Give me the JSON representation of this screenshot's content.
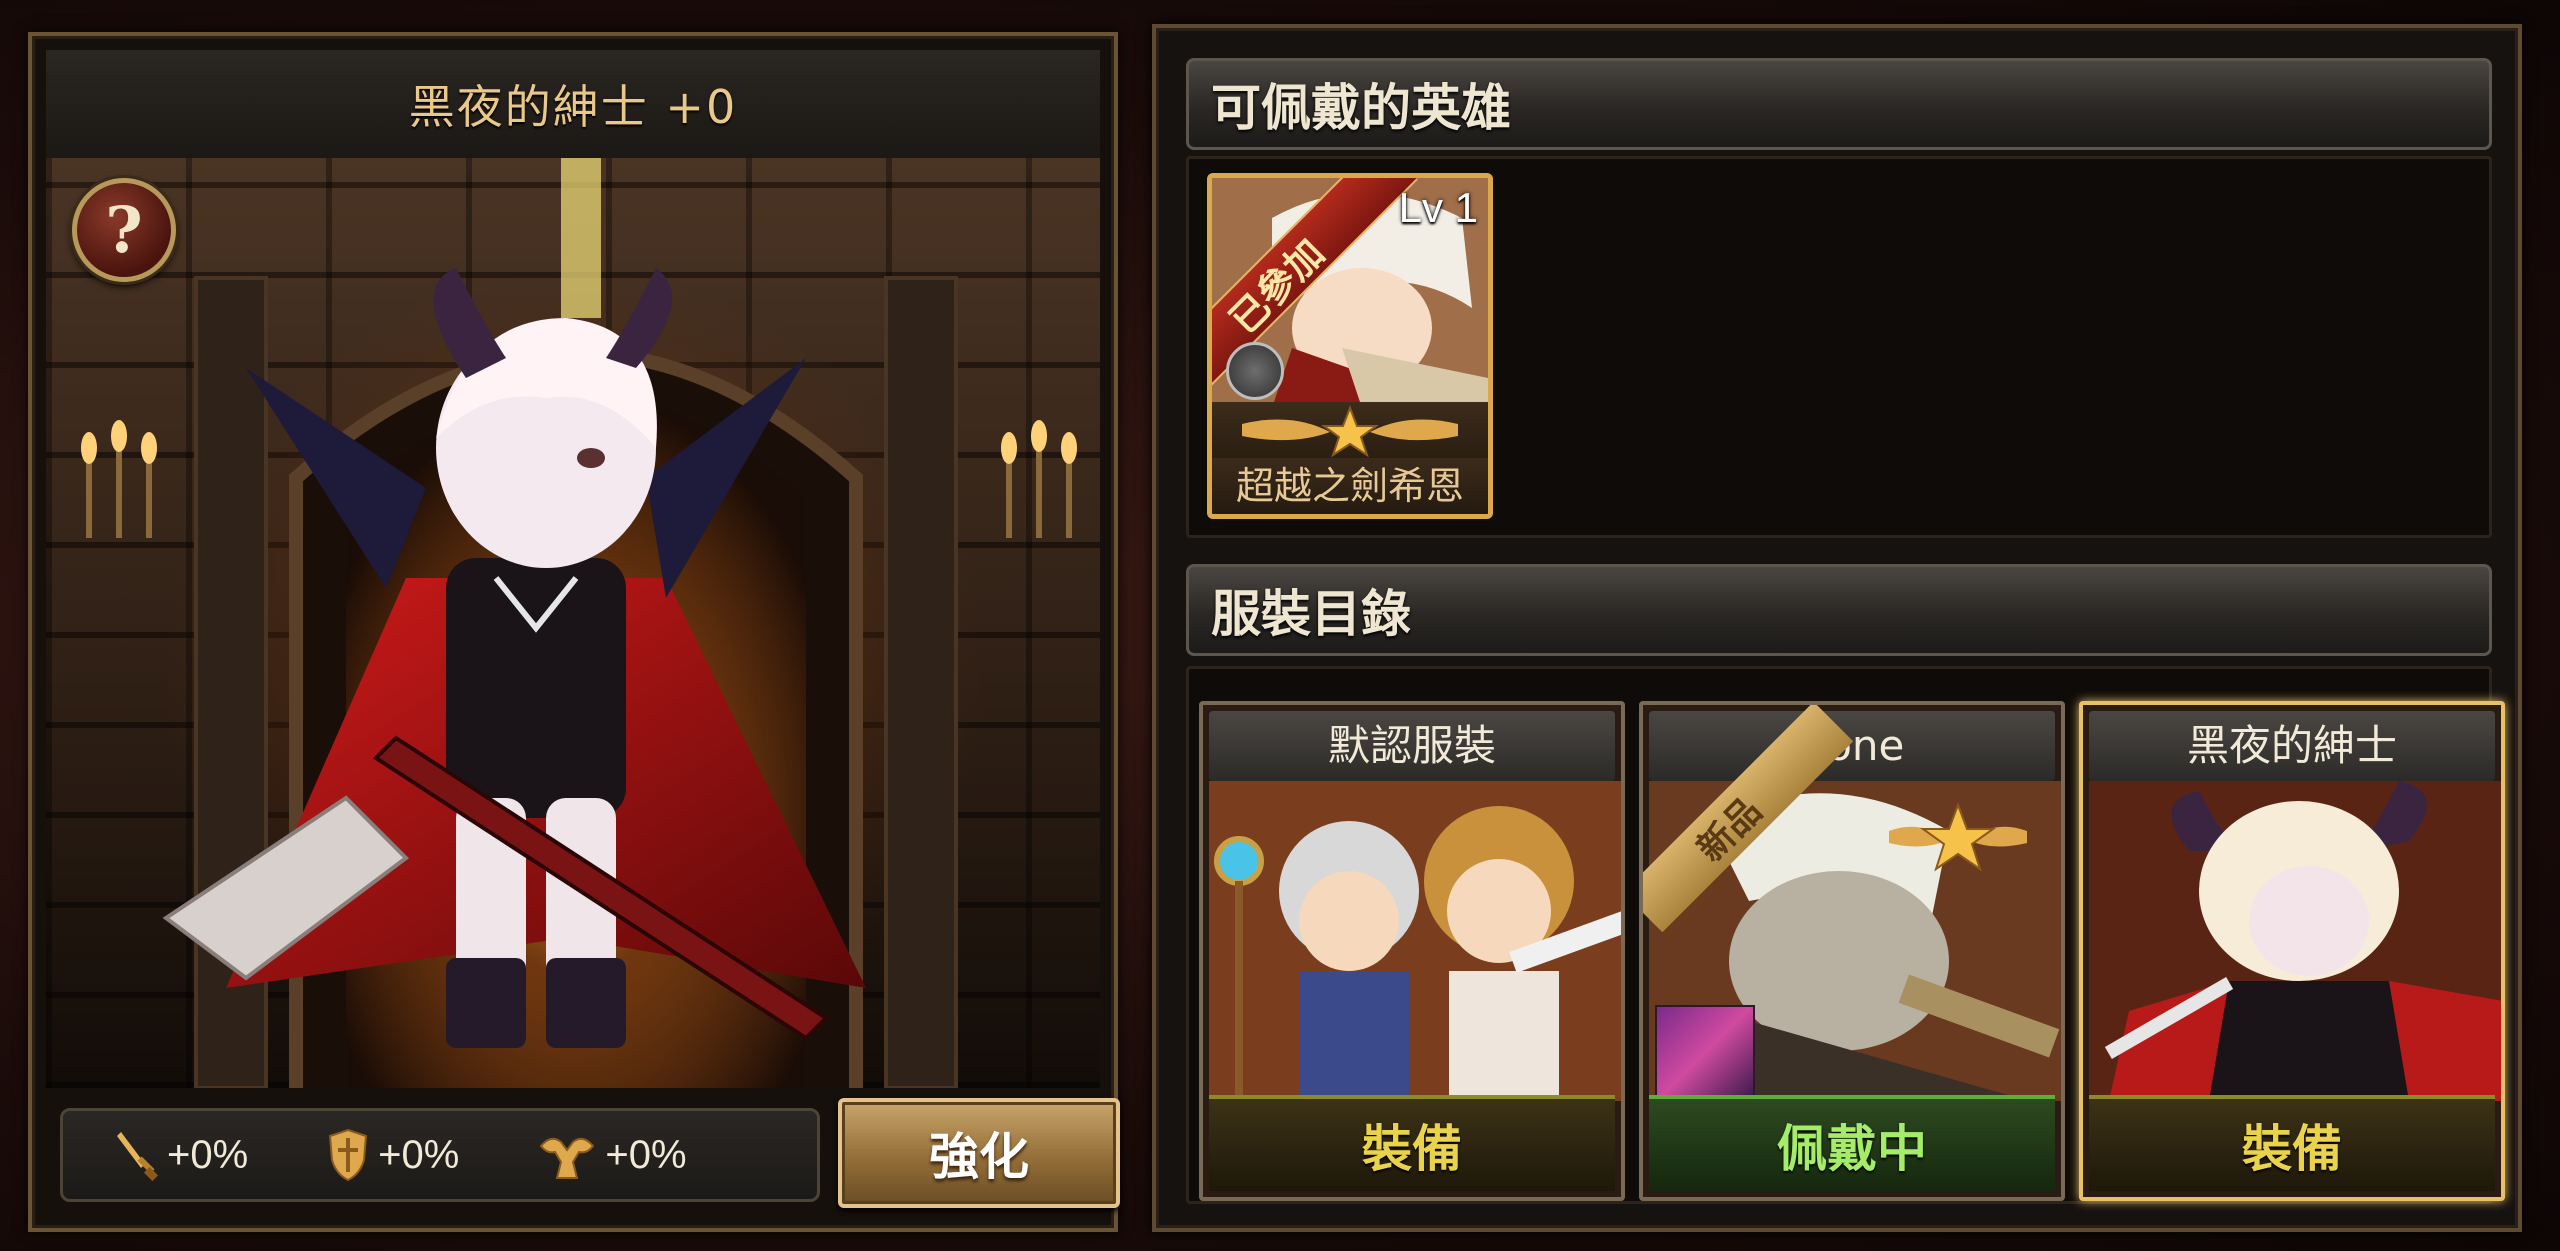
{
  "left_panel": {
    "title": "黑夜的紳士 +0",
    "help_label": "?",
    "stats": [
      {
        "icon": "sword-icon",
        "value": "+0%"
      },
      {
        "icon": "shield-icon",
        "value": "+0%"
      },
      {
        "icon": "muscle-icon",
        "value": "+0%"
      }
    ],
    "enhance_label": "強化"
  },
  "heroes_section": {
    "header": "可佩戴的英雄",
    "heroes": [
      {
        "level": "Lv 1",
        "ribbon": "已參加",
        "name": "超越之劍希恩"
      }
    ]
  },
  "costume_section": {
    "header": "服裝目錄",
    "costumes": [
      {
        "title": "默認服裝",
        "action": "裝備",
        "state": "equip"
      },
      {
        "title": "none",
        "action": "佩戴中",
        "state": "wearing",
        "ribbon": "新品"
      },
      {
        "title": "黑夜的紳士",
        "action": "裝備",
        "state": "equip",
        "selected": true
      }
    ]
  },
  "colors": {
    "gold_border": "#d9a94b",
    "equip_text": "#e9d24c",
    "wearing_text": "#a5ec6a",
    "title_text": "#e9c889"
  }
}
